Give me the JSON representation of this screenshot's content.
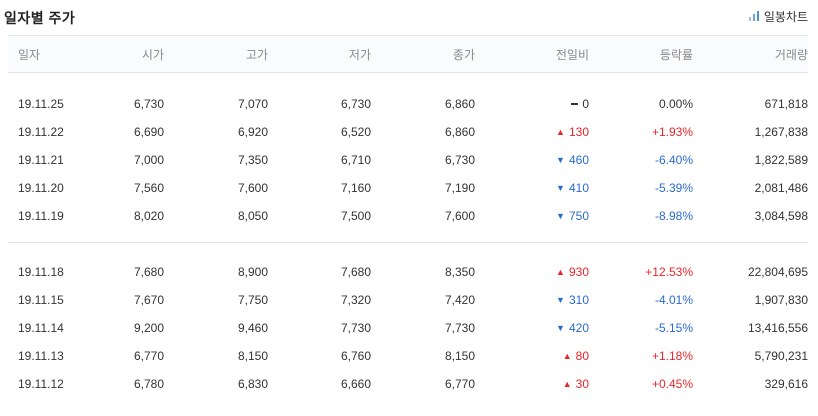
{
  "header": {
    "title": "일자별 주가",
    "chart_button_label": "일봉차트"
  },
  "columns": [
    "일자",
    "시가",
    "고가",
    "저가",
    "종가",
    "전일비",
    "등락률",
    "거래량"
  ],
  "rows": [
    {
      "date": "19.11.25",
      "open": "6,730",
      "high": "7,070",
      "low": "6,730",
      "close": "6,860",
      "dir": "flat",
      "change": "0",
      "rate": "0.00%",
      "volume": "671,818"
    },
    {
      "date": "19.11.22",
      "open": "6,690",
      "high": "6,920",
      "low": "6,520",
      "close": "6,860",
      "dir": "up",
      "change": "130",
      "rate": "+1.93%",
      "volume": "1,267,838"
    },
    {
      "date": "19.11.21",
      "open": "7,000",
      "high": "7,350",
      "low": "6,710",
      "close": "6,730",
      "dir": "down",
      "change": "460",
      "rate": "-6.40%",
      "volume": "1,822,589"
    },
    {
      "date": "19.11.20",
      "open": "7,560",
      "high": "7,600",
      "low": "7,160",
      "close": "7,190",
      "dir": "down",
      "change": "410",
      "rate": "-5.39%",
      "volume": "2,081,486"
    },
    {
      "date": "19.11.19",
      "open": "8,020",
      "high": "8,050",
      "low": "7,500",
      "close": "7,600",
      "dir": "down",
      "change": "750",
      "rate": "-8.98%",
      "volume": "3,084,598"
    },
    {
      "date": "19.11.18",
      "open": "7,680",
      "high": "8,900",
      "low": "7,680",
      "close": "8,350",
      "dir": "up",
      "change": "930",
      "rate": "+12.53%",
      "volume": "22,804,695"
    },
    {
      "date": "19.11.15",
      "open": "7,670",
      "high": "7,750",
      "low": "7,320",
      "close": "7,420",
      "dir": "down",
      "change": "310",
      "rate": "-4.01%",
      "volume": "1,907,830"
    },
    {
      "date": "19.11.14",
      "open": "9,200",
      "high": "9,460",
      "low": "7,730",
      "close": "7,730",
      "dir": "down",
      "change": "420",
      "rate": "-5.15%",
      "volume": "13,416,556"
    },
    {
      "date": "19.11.13",
      "open": "6,770",
      "high": "8,150",
      "low": "6,760",
      "close": "8,150",
      "dir": "up",
      "change": "80",
      "rate": "+1.18%",
      "volume": "5,790,231"
    },
    {
      "date": "19.11.12",
      "open": "6,780",
      "high": "6,830",
      "low": "6,660",
      "close": "6,770",
      "dir": "up",
      "change": "30",
      "rate": "+0.45%",
      "volume": "329,616"
    }
  ],
  "colors": {
    "up": "#e8252a",
    "down": "#2b6bcc",
    "flat": "#333333"
  },
  "icons": {
    "chart_button": "bar-chart-icon",
    "up": "triangle-up-icon",
    "down": "triangle-down-icon",
    "flat": "dash-icon"
  }
}
